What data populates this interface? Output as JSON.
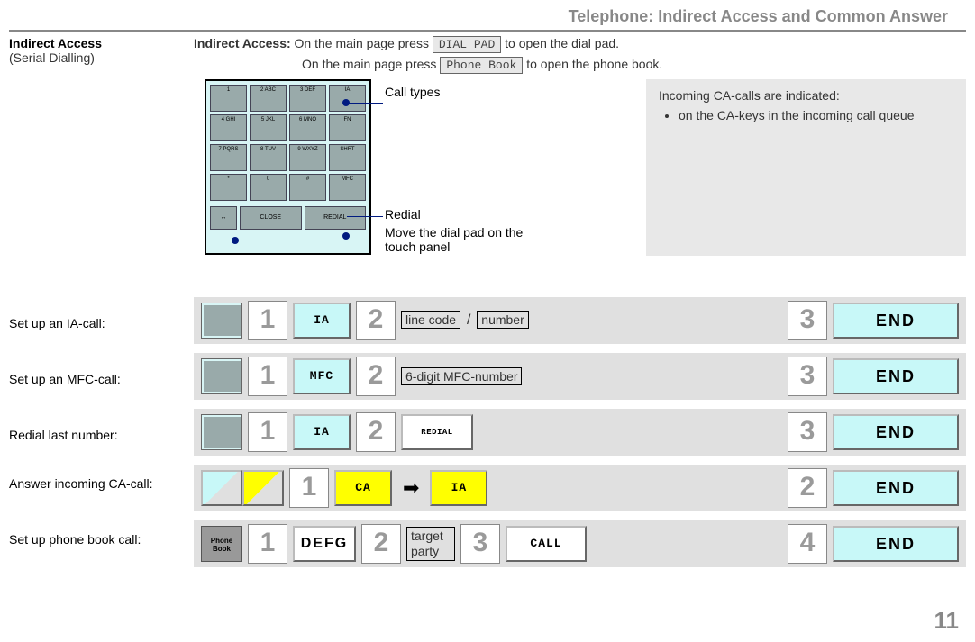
{
  "header": "Telephone: Indirect Access and Common Answer",
  "page_number": "11",
  "sidebar": {
    "title": "Indirect Access",
    "subtitle": "(Serial Dialling)"
  },
  "intro": {
    "heading": "Indirect Access:",
    "line1_a": "On the main page press",
    "btn_dialpad": "DIAL PAD",
    "line1_b": "to open the dial pad.",
    "line2_a": "On the main page press",
    "btn_phonebook": "Phone Book",
    "line2_b": "to open the phone book."
  },
  "annotations": {
    "call_types": "Call types",
    "redial": "Redial",
    "move": "Move the dial pad on the touch panel"
  },
  "keypad": {
    "keys": [
      "1",
      "2 ABC",
      "3 DEF",
      "IA",
      "4 GHI",
      "5 JKL",
      "6 MNO",
      "FN",
      "7 PQRS",
      "8 TUV",
      "9 WXYZ",
      "SHRT",
      "*",
      "0",
      "#",
      "MFC"
    ],
    "bottom_arrow": "↔",
    "bottom_close": "CLOSE",
    "bottom_redial": "REDIAL"
  },
  "infobox": {
    "title": "Incoming CA-calls are indicated:",
    "bullet": "on the CA-keys in the incoming call queue"
  },
  "rowLabels": {
    "ia": "Set up an IA-call:",
    "mfc": "Set up an MFC-call:",
    "redial": "Redial last number:",
    "answer": "Answer incoming CA-call:",
    "pbook": "Set up phone book call:"
  },
  "buttons": {
    "ia": "IA",
    "mfc": "MFC",
    "redial": "REDIAL",
    "ca": "CA",
    "defg": "DEFG",
    "call": "CALL",
    "end": "END",
    "phonebook_mini": "Phone Book"
  },
  "texts": {
    "linecode": "line code",
    "number": "number",
    "mfc6": "6-digit MFC-number",
    "target": "target party"
  },
  "steps": {
    "s1": "1",
    "s2": "2",
    "s3": "3",
    "s4": "4"
  }
}
